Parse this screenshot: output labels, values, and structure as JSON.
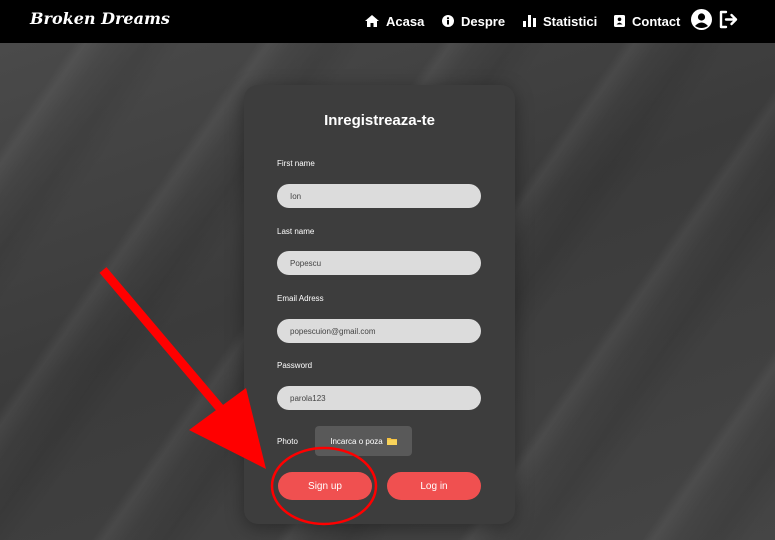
{
  "brand": "Broken Dreams",
  "nav": {
    "acasa": "Acasa",
    "despre": "Despre",
    "statistici": "Statistici",
    "contact": "Contact"
  },
  "form": {
    "title": "Inregistreaza-te",
    "first_name_label": "First name",
    "first_name_value": "Ion",
    "last_name_label": "Last name",
    "last_name_value": "Popescu",
    "email_label": "Email Adress",
    "email_value": "popescuion@gmail.com",
    "password_label": "Password",
    "password_value": "parola123",
    "photo_label": "Photo",
    "photo_button": "Incarca o poza",
    "signup_button": "Sign up",
    "login_button": "Log in"
  },
  "colors": {
    "navbar": "#000000",
    "card": "#3d3d3d",
    "accent_button": "#f05050",
    "input_bg": "#dcdcdc",
    "annotation": "#ff0000"
  },
  "icons": [
    "home-icon",
    "info-icon",
    "bar-chart-icon",
    "contact-card-icon",
    "user-icon",
    "logout-icon",
    "folder-icon"
  ]
}
